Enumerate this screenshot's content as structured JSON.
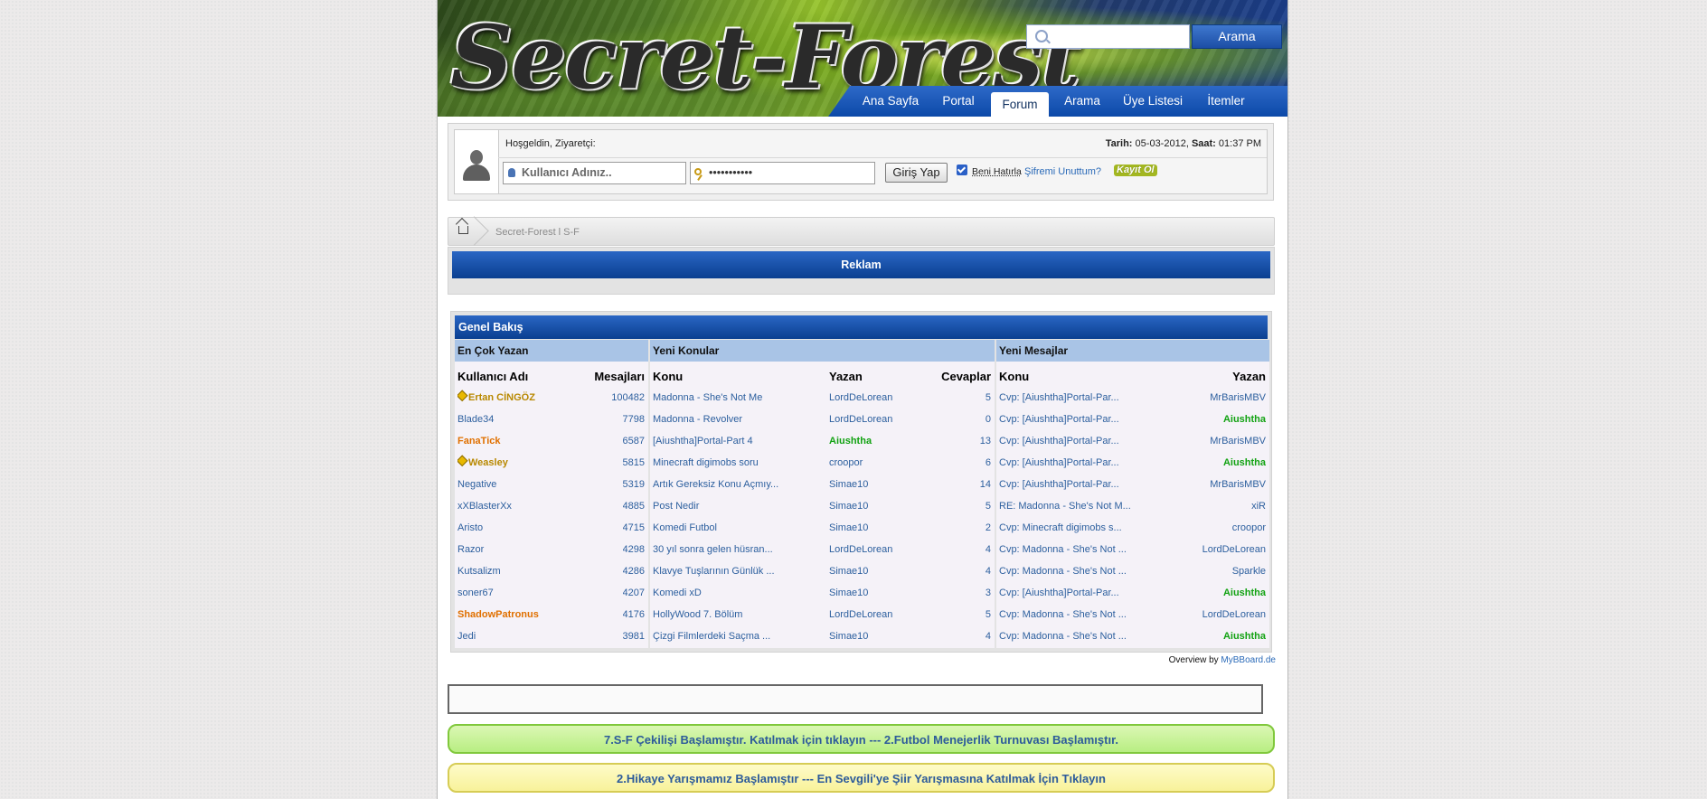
{
  "header": {
    "logo_text": "Secret-Forest",
    "search": {
      "placeholder": "",
      "button_label": "Arama"
    },
    "nav": [
      {
        "label": "Ana Sayfa",
        "active": false
      },
      {
        "label": "Portal",
        "active": false
      },
      {
        "label": "Forum",
        "active": true
      },
      {
        "label": "Arama",
        "active": false
      },
      {
        "label": "Üye Listesi",
        "active": false
      },
      {
        "label": "İtemler",
        "active": false
      }
    ]
  },
  "welcome": {
    "greeting": "Hoşgeldin, Ziyaretçi:",
    "date_label": "Tarih:",
    "date_value": "05-03-2012,",
    "time_label": "Saat:",
    "time_value": "01:37 PM",
    "username_placeholder": "Kullanıcı Adınız..",
    "password_value": "•••••••••••",
    "login_button": "Giriş Yap",
    "remember_checked": true,
    "remember_label": "Beni Hatırla",
    "forgot_link": "Şifremi Unuttum?",
    "register_link": "Kayıt Ol"
  },
  "breadcrumb": {
    "text": "Secret-Forest l S-F"
  },
  "ad_panel": {
    "title": "Reklam"
  },
  "overview": {
    "title": "Genel Bakış",
    "top_posters": {
      "heading": "En Çok Yazan",
      "col_user": "Kullanıcı Adı",
      "col_posts": "Mesajları",
      "rows": [
        {
          "name": "Ertan CİNGÖZ",
          "posts": "100482",
          "style": "gold",
          "diamond": true
        },
        {
          "name": "Blade34",
          "posts": "7798",
          "style": "blue",
          "diamond": false
        },
        {
          "name": "FanaTick",
          "posts": "6587",
          "style": "orange",
          "diamond": false
        },
        {
          "name": "Weasley",
          "posts": "5815",
          "style": "gold",
          "diamond": true
        },
        {
          "name": "Negative",
          "posts": "5319",
          "style": "blue",
          "diamond": false
        },
        {
          "name": "xXBlasterXx",
          "posts": "4885",
          "style": "blue",
          "diamond": false
        },
        {
          "name": "Aristo",
          "posts": "4715",
          "style": "blue",
          "diamond": false
        },
        {
          "name": "Razor",
          "posts": "4298",
          "style": "blue",
          "diamond": false
        },
        {
          "name": "Kutsalizm",
          "posts": "4286",
          "style": "blue",
          "diamond": false
        },
        {
          "name": "soner67",
          "posts": "4207",
          "style": "blue",
          "diamond": false
        },
        {
          "name": "ShadowPatronus",
          "posts": "4176",
          "style": "orange",
          "diamond": false
        },
        {
          "name": "Jedi",
          "posts": "3981",
          "style": "blue",
          "diamond": false
        }
      ]
    },
    "new_threads": {
      "heading": "Yeni Konular",
      "col_topic": "Konu",
      "col_author": "Yazan",
      "col_replies": "Cevaplar",
      "rows": [
        {
          "topic": "Madonna - She's Not Me",
          "author": "LordDeLorean",
          "author_style": "blue",
          "replies": "5"
        },
        {
          "topic": "Madonna - Revolver",
          "author": "LordDeLorean",
          "author_style": "blue",
          "replies": "0"
        },
        {
          "topic": "[Aiushtha]Portal-Part 4",
          "author": "Aiushtha",
          "author_style": "green",
          "replies": "13"
        },
        {
          "topic": "Minecraft digimobs soru",
          "author": "croopor",
          "author_style": "blue",
          "replies": "6"
        },
        {
          "topic": "Artık Gereksiz Konu Açmıy...",
          "author": "Simae10",
          "author_style": "blue",
          "replies": "14"
        },
        {
          "topic": "Post Nedir",
          "author": "Simae10",
          "author_style": "blue",
          "replies": "5"
        },
        {
          "topic": "Komedi Futbol",
          "author": "Simae10",
          "author_style": "blue",
          "replies": "2"
        },
        {
          "topic": "30 yıl sonra gelen hüsran...",
          "author": "LordDeLorean",
          "author_style": "blue",
          "replies": "4"
        },
        {
          "topic": "Klavye Tuşlarının Günlük ...",
          "author": "Simae10",
          "author_style": "blue",
          "replies": "4"
        },
        {
          "topic": "Komedi xD",
          "author": "Simae10",
          "author_style": "blue",
          "replies": "3"
        },
        {
          "topic": "HollyWood 7. Bölüm",
          "author": "LordDeLorean",
          "author_style": "blue",
          "replies": "5"
        },
        {
          "topic": "Çizgi Filmlerdeki Saçma ...",
          "author": "Simae10",
          "author_style": "blue",
          "replies": "4"
        }
      ]
    },
    "new_posts": {
      "heading": "Yeni Mesajlar",
      "col_topic": "Konu",
      "col_author": "Yazan",
      "rows": [
        {
          "topic": "Cvp: [Aiushtha]Portal-Par...",
          "author": "MrBarisMBV",
          "author_style": "blue"
        },
        {
          "topic": "Cvp: [Aiushtha]Portal-Par...",
          "author": "Aiushtha",
          "author_style": "green"
        },
        {
          "topic": "Cvp: [Aiushtha]Portal-Par...",
          "author": "MrBarisMBV",
          "author_style": "blue"
        },
        {
          "topic": "Cvp: [Aiushtha]Portal-Par...",
          "author": "Aiushtha",
          "author_style": "green"
        },
        {
          "topic": "Cvp: [Aiushtha]Portal-Par...",
          "author": "MrBarisMBV",
          "author_style": "blue"
        },
        {
          "topic": "RE: Madonna - She's Not M...",
          "author": "xiR",
          "author_style": "blue"
        },
        {
          "topic": "Cvp: Minecraft digimobs s...",
          "author": "croopor",
          "author_style": "blue"
        },
        {
          "topic": "Cvp: Madonna - She's Not ...",
          "author": "LordDeLorean",
          "author_style": "blue"
        },
        {
          "topic": "Cvp: Madonna - She's Not ...",
          "author": "Sparkle",
          "author_style": "blue"
        },
        {
          "topic": "Cvp: [Aiushtha]Portal-Par...",
          "author": "Aiushtha",
          "author_style": "green"
        },
        {
          "topic": "Cvp: Madonna - She's Not ...",
          "author": "LordDeLorean",
          "author_style": "blue"
        },
        {
          "topic": "Cvp: Madonna - She's Not ...",
          "author": "Aiushtha",
          "author_style": "green"
        }
      ]
    },
    "credit_prefix": "Overview by",
    "credit_link": "MyBBoard.de"
  },
  "announcements": [
    "7.S-F Çekilişi Başlamıştır. Katılmak için tıklayın --- 2.Futbol Menejerlik Turnuvası Başlamıştır.",
    "2.Hikaye Yarışmamız Başlamıştır --- En Sevgili'ye Şiir Yarışmasına Katılmak İçin Tıklayın"
  ]
}
